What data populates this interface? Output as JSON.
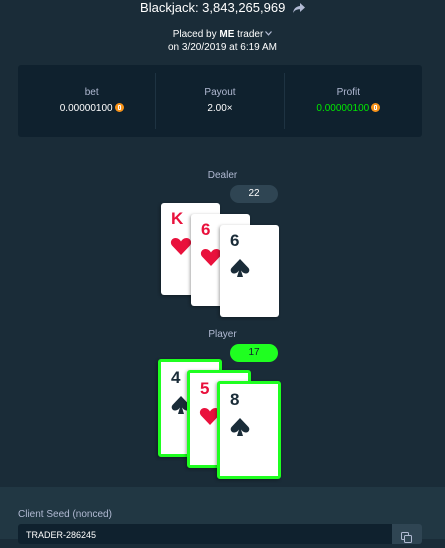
{
  "header": {
    "title": "Blackjack: 3,843,265,969",
    "placed_prefix": "Placed by",
    "user": "ME",
    "trader": "trader",
    "date": "on 3/20/2019 at 6:19 AM"
  },
  "stats": [
    {
      "label": "bet",
      "value": "0.00000100",
      "coin": true,
      "color": "#ffffff"
    },
    {
      "label": "Payout",
      "value": "2.00×",
      "coin": false,
      "color": "#ffffff"
    },
    {
      "label": "Profit",
      "value": "0.00000100",
      "coin": true,
      "color": "#00e701"
    }
  ],
  "dealer": {
    "label": "Dealer",
    "score": "22",
    "cards": [
      {
        "rank": "K",
        "suit": "hearts"
      },
      {
        "rank": "6",
        "suit": "hearts"
      },
      {
        "rank": "6",
        "suit": "spades"
      }
    ]
  },
  "player": {
    "label": "Player",
    "score": "17",
    "cards": [
      {
        "rank": "4",
        "suit": "spades"
      },
      {
        "rank": "5",
        "suit": "hearts"
      },
      {
        "rank": "8",
        "suit": "spades"
      }
    ]
  },
  "seed": {
    "label": "Client Seed (nonced)",
    "value": "TRADER-286245"
  },
  "colors": {
    "background": "#1a2c38",
    "panel": "#0f212e",
    "win_green": "#1fff20",
    "profit_green": "#00e701",
    "red_suit": "#e9113c",
    "coin": "#f7931a"
  }
}
